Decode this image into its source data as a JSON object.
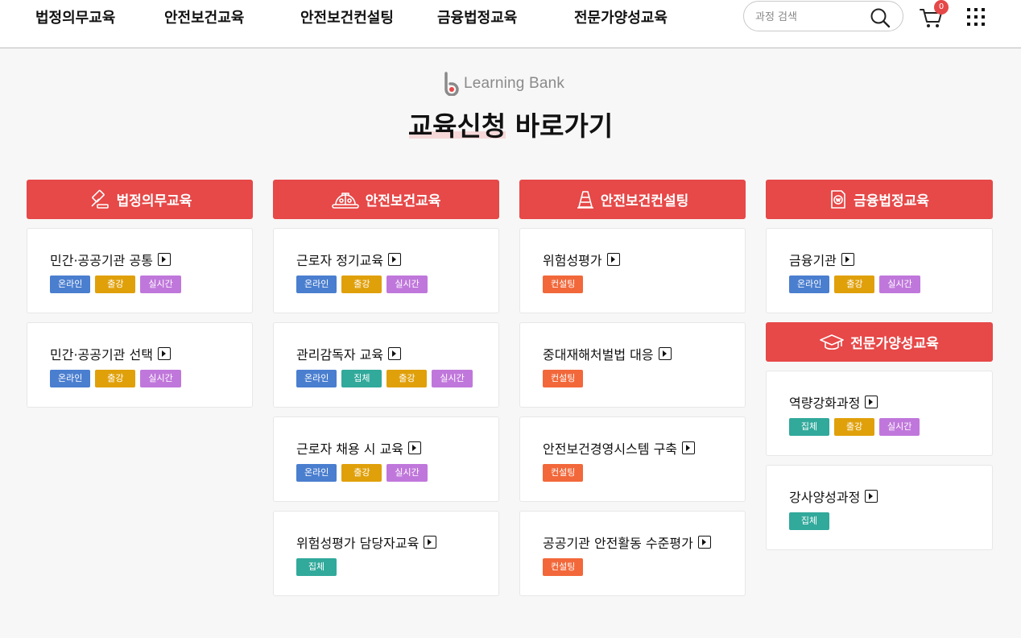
{
  "nav": {
    "items": [
      "법정의무교육",
      "안전보건교육",
      "안전보건컨설팅",
      "금융법정교육",
      "전문가양성교육"
    ]
  },
  "search": {
    "placeholder": "과정 검색"
  },
  "cart": {
    "count": "0"
  },
  "brand": {
    "name": "Learning Bank"
  },
  "page": {
    "title": "교육신청 바로가기"
  },
  "tag_labels": {
    "online": "온라인",
    "chulgang": "출강",
    "realtime": "실시간",
    "jiphap": "집체",
    "consulting": "컨설팅"
  },
  "colors": {
    "header_red": "#e74848",
    "online": "#4a7ecf",
    "chulgang": "#e0a00a",
    "realtime": "#c077db",
    "jiphap": "#31a99b",
    "consulting": "#f2683a"
  },
  "columns": [
    {
      "title": "법정의무교육",
      "icon": "gavel-icon",
      "cards": [
        {
          "title": "민간·공공기관 공통",
          "tags": [
            "온라인",
            "출강",
            "실시간"
          ]
        },
        {
          "title": "민간·공공기관 선택",
          "tags": [
            "온라인",
            "출강",
            "실시간"
          ]
        }
      ]
    },
    {
      "title": "안전보건교육",
      "icon": "hard-hat-icon",
      "cards": [
        {
          "title": "근로자 정기교육",
          "tags": [
            "온라인",
            "출강",
            "실시간"
          ]
        },
        {
          "title": "관리감독자 교육",
          "tags": [
            "온라인",
            "집체",
            "출강",
            "실시간"
          ]
        },
        {
          "title": "근로자 채용 시 교육",
          "tags": [
            "온라인",
            "출강",
            "실시간"
          ]
        },
        {
          "title": "위험성평가 담당자교육",
          "tags": [
            "집체"
          ]
        }
      ]
    },
    {
      "title": "안전보건컨설팅",
      "icon": "traffic-cone-icon",
      "cards": [
        {
          "title": "위험성평가",
          "tags": [
            "컨설팅"
          ]
        },
        {
          "title": "중대재해처벌법 대응",
          "tags": [
            "컨설팅"
          ]
        },
        {
          "title": "안전보건경영시스템 구축",
          "tags": [
            "컨설팅"
          ]
        },
        {
          "title": "공공기관 안전활동 수준평가",
          "tags": [
            "컨설팅"
          ]
        }
      ]
    },
    {
      "title": "금융법정교육",
      "icon": "finance-document-icon",
      "cards": [
        {
          "title": "금융기관",
          "tags": [
            "온라인",
            "출강",
            "실시간"
          ]
        }
      ]
    },
    {
      "title": "전문가양성교육",
      "icon": "graduation-cap-icon",
      "cards": [
        {
          "title": "역량강화과정",
          "tags": [
            "집체",
            "출강",
            "실시간"
          ]
        },
        {
          "title": "강사양성과정",
          "tags": [
            "집체"
          ]
        }
      ]
    }
  ]
}
